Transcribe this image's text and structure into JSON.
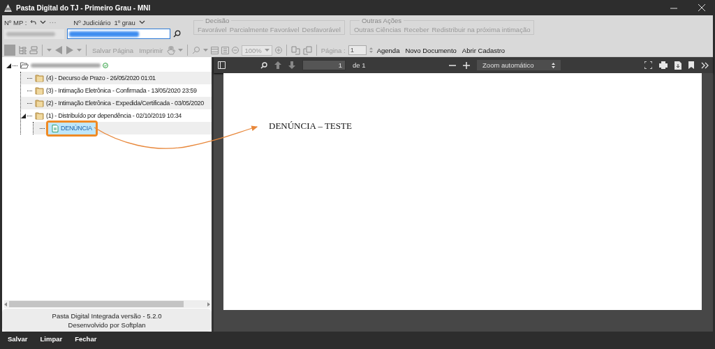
{
  "window": {
    "title": "Pasta Digital do TJ - Primeiro Grau - MNI"
  },
  "header": {
    "mp_label": "Nº MP :",
    "judiciario_label": "Nº Judiciário",
    "grau": "1º grau"
  },
  "decisao": {
    "title": "Decisão",
    "buttons": [
      {
        "label": "Favorável",
        "disabled": true
      },
      {
        "label": "Parcialmente Favorável",
        "disabled": true
      },
      {
        "label": "Desfavorável",
        "disabled": true
      }
    ]
  },
  "outras_acoes": {
    "title": "Outras Ações",
    "buttons": [
      {
        "label": "Outras Ciências",
        "disabled": true
      },
      {
        "label": "Receber",
        "disabled": true
      },
      {
        "label": "Redistribuir na próxima intimação",
        "disabled": true
      }
    ]
  },
  "toolbar": {
    "page_buttons": [
      {
        "label": "Salvar Página",
        "disabled": true
      },
      {
        "label": "Imprimir",
        "disabled": true
      }
    ],
    "zoom": "100%",
    "page_label": "Página :",
    "page_value": "1",
    "actions": [
      {
        "label": "Agenda",
        "disabled": false
      },
      {
        "label": "Novo Documento",
        "disabled": false
      },
      {
        "label": "Abrir Cadastro",
        "disabled": false
      }
    ]
  },
  "tree": {
    "root": {
      "expanded": true,
      "children": [
        {
          "label": "(4) - Decurso de Prazo - 26/05/2020 01:01",
          "selected": false
        },
        {
          "label": "(3) - Intimação Eletrônica - Confirmada - 13/05/2020 23:59",
          "selected": false
        },
        {
          "label": "(2) - Intimação Eletrônica - Expedida/Certificada - 03/05/2020",
          "selected": false
        },
        {
          "label": "(1) - Distribuído por dependência - 02/10/2019 10:34",
          "expanded": true,
          "selected": false,
          "children": [
            {
              "label": "DENÚNCIA",
              "kind": "document",
              "selected": true
            }
          ]
        }
      ]
    }
  },
  "panel_footer": {
    "lines": [
      "Pasta Digital Integrada versão - 5.2.0",
      "Desenvolvido por Softplan"
    ]
  },
  "viewer": {
    "page_value": "1",
    "page_total": "de 1",
    "zoom": "Zoom automático",
    "document_text": "DENÚNCIA – TESTE"
  },
  "annotation": {
    "highlight_selected": true,
    "arrow_to_document": true
  },
  "bottom_bar": {
    "buttons": [
      "Salvar",
      "Limpar",
      "Fechar"
    ]
  }
}
